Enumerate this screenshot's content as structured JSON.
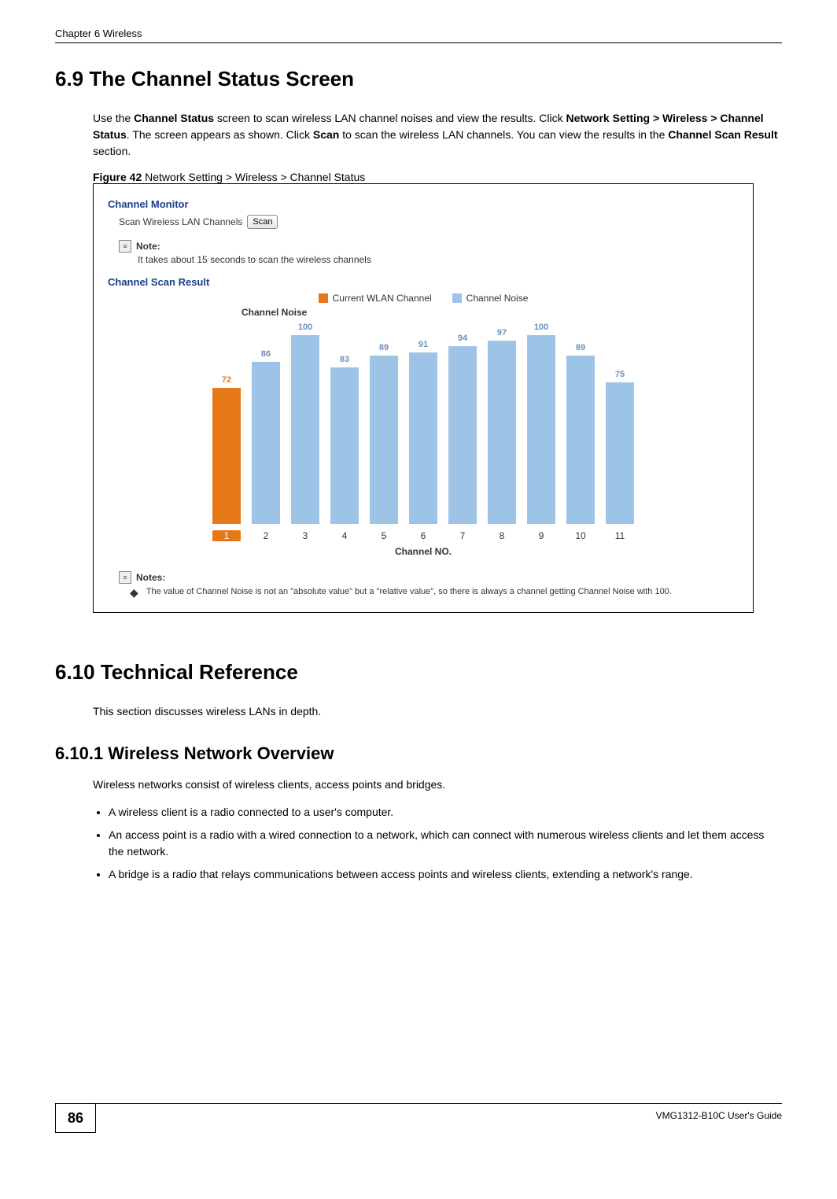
{
  "header": {
    "chapter_label": "Chapter 6 Wireless"
  },
  "section_6_9": {
    "heading": "6.9  The Channel Status Screen",
    "para_parts": {
      "p1a": "Use the ",
      "p1b": "Channel Status",
      "p1c": " screen to scan wireless LAN channel noises and view the results. Click ",
      "p1d": "Network Setting > Wireless > Channel Status",
      "p1e": ". The screen appears as shown. Click ",
      "p1f": "Scan",
      "p1g": " to scan the wireless LAN channels. You can view the results in the ",
      "p1h": "Channel Scan Result",
      "p1i": " section."
    },
    "figure_caption_prefix": "Figure 42",
    "figure_caption_rest": "   Network Setting > Wireless > Channel Status"
  },
  "figure42": {
    "monitor_title": "Channel Monitor",
    "scan_label": "Scan Wireless LAN Channels",
    "scan_button": "Scan",
    "note_label": "Note:",
    "note_text": "It takes about 15 seconds to scan the wireless channels",
    "result_title": "Channel Scan Result",
    "legend": {
      "current": "Current WLAN Channel",
      "noise": "Channel Noise"
    },
    "yaxis_title": "Channel Noise",
    "xlabel": "Channel NO.",
    "notes2_label": "Notes:",
    "notes2_text": "The value of Channel Noise is not an \"absolute value\" but a \"relative value\", so there is always a channel getting Channel Noise with 100."
  },
  "chart_data": {
    "type": "bar",
    "title": "Channel Noise",
    "xlabel": "Channel NO.",
    "ylabel": "Channel Noise",
    "ylim": [
      0,
      100
    ],
    "categories": [
      "1",
      "2",
      "3",
      "4",
      "5",
      "6",
      "7",
      "8",
      "9",
      "10",
      "11"
    ],
    "series": [
      {
        "name": "Current WLAN Channel",
        "color": "#e67817",
        "values": [
          72,
          null,
          null,
          null,
          null,
          null,
          null,
          null,
          null,
          null,
          null
        ]
      },
      {
        "name": "Channel Noise",
        "color": "#9dc3e6",
        "values": [
          null,
          86,
          100,
          83,
          89,
          91,
          94,
          97,
          100,
          89,
          75
        ]
      }
    ],
    "current_channel_index": 0
  },
  "section_6_10": {
    "heading": "6.10  Technical Reference",
    "para": "This section discusses wireless LANs in depth."
  },
  "section_6_10_1": {
    "heading": "6.10.1  Wireless Network Overview",
    "para": "Wireless networks consist of wireless clients, access points and bridges.",
    "bullets": [
      "A wireless client is a radio connected to a user's computer.",
      "An access point is a radio with a wired connection to a network, which can connect with numerous wireless clients and let them access the network.",
      "A bridge is a radio that relays communications between access points and wireless clients, extending a network's range."
    ]
  },
  "footer": {
    "page_number": "86",
    "guide": "VMG1312-B10C User's Guide"
  }
}
